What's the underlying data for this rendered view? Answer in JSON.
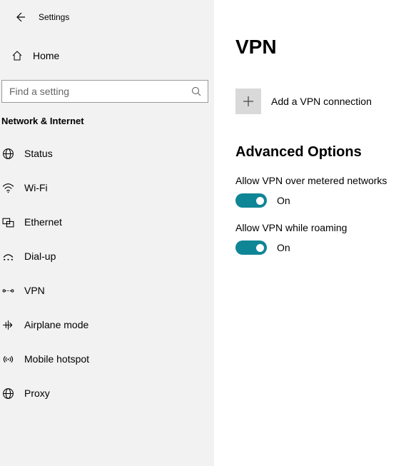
{
  "header": {
    "title": "Settings"
  },
  "home": {
    "label": "Home"
  },
  "search": {
    "placeholder": "Find a setting"
  },
  "category": {
    "title": "Network & Internet"
  },
  "nav": {
    "items": [
      {
        "label": "Status"
      },
      {
        "label": "Wi-Fi"
      },
      {
        "label": "Ethernet"
      },
      {
        "label": "Dial-up"
      },
      {
        "label": "VPN"
      },
      {
        "label": "Airplane mode"
      },
      {
        "label": "Mobile hotspot"
      },
      {
        "label": "Proxy"
      }
    ]
  },
  "main": {
    "title": "VPN",
    "add_label": "Add a VPN connection",
    "section_title": "Advanced Options",
    "options": [
      {
        "label": "Allow VPN over metered networks",
        "state": "On"
      },
      {
        "label": "Allow VPN while roaming",
        "state": "On"
      }
    ]
  },
  "colors": {
    "accent": "#0f8696"
  }
}
